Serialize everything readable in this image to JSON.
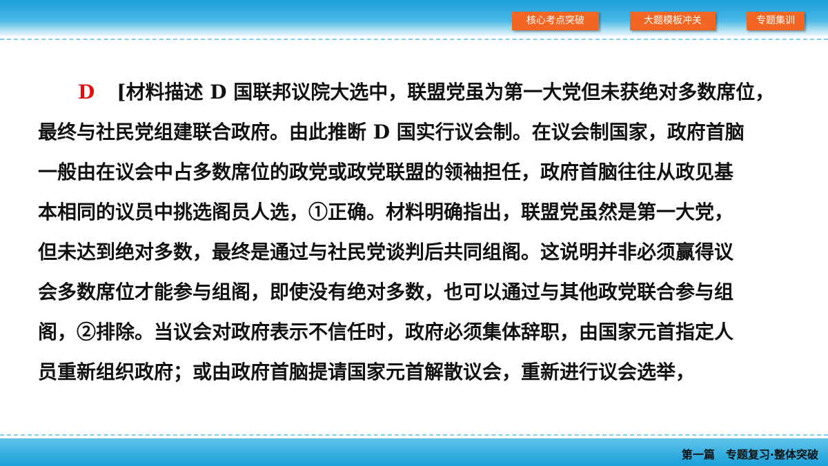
{
  "nav": {
    "core": "核心考点突破",
    "template": "大题模板冲关",
    "training": "专题集训"
  },
  "answer": "D",
  "paragraph": [
    "[材料描述 D 国联邦议院大选中，联盟党虽为第一大党但未获绝对多数席位，",
    "最终与社民党组建联合政府。由此推断 D 国实行议会制。在议会制国家，政府首脑",
    "一般由在议会中占多数席位的政党或政党联盟的领袖担任，政府首脑往往从政见基",
    "本相同的议员中挑选阁员人选，①正确。材料明确指出，联盟党虽然是第一大党，",
    "但未达到绝对多数，最终是通过与社民党谈判后共同组阁。这说明并非必须赢得议",
    "会多数席位才能参与组阁，即使没有绝对多数，也可以通过与其他政党联合参与组",
    "阁，②排除。当议会对政府表示不信任时，政府必须集体辞职，由国家元首指定人",
    "员重新组织政府；或由政府首脑提请国家元首解散议会，重新进行议会选举，"
  ],
  "footer": {
    "part": "第一篇",
    "title": "专题复习·整体突破"
  }
}
